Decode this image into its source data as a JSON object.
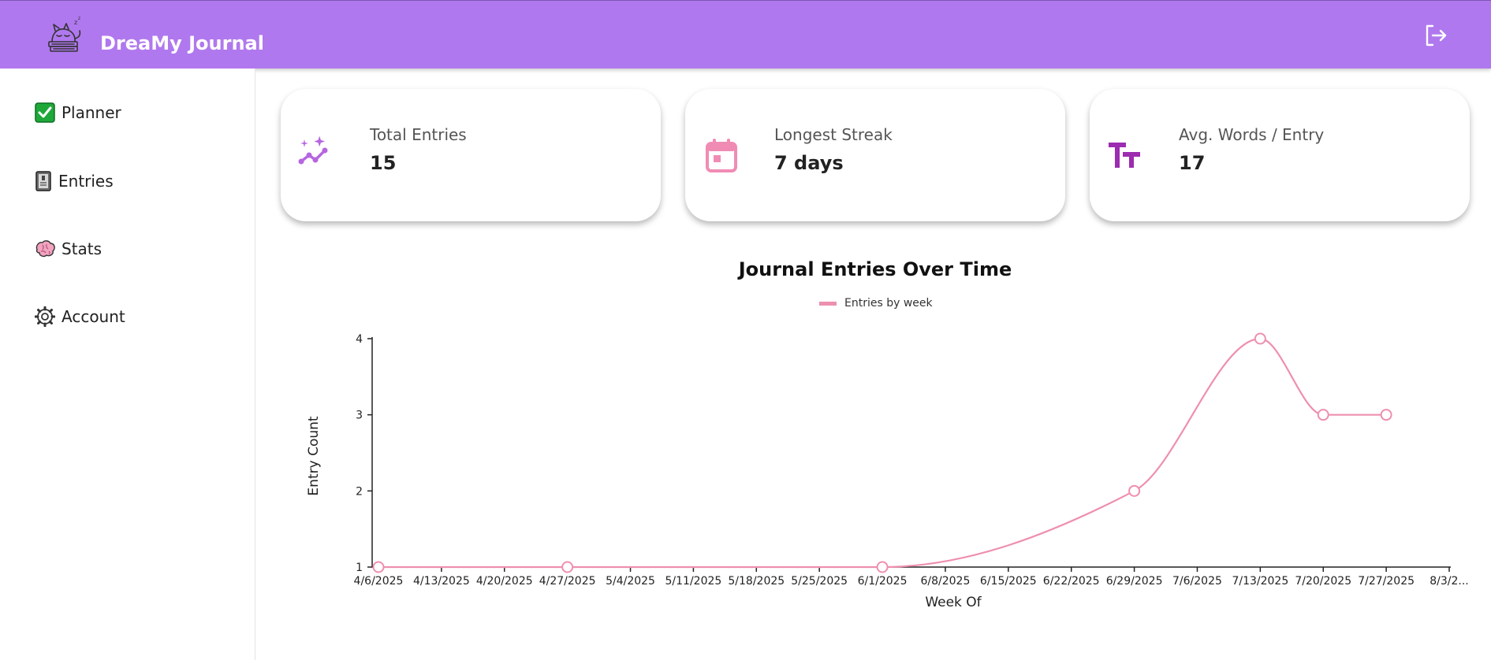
{
  "app": {
    "title": "DreaMy Journal",
    "logo_icon": "sleeping-cat-on-books-icon",
    "logout_icon": "logout-icon"
  },
  "sidebar": {
    "items": [
      {
        "label": "Planner",
        "icon": "checkmark-box-icon"
      },
      {
        "label": "Entries",
        "icon": "notebook-icon"
      },
      {
        "label": "Stats",
        "icon": "brain-icon"
      },
      {
        "label": "Account",
        "icon": "gear-icon"
      }
    ]
  },
  "stats": {
    "cards": [
      {
        "label": "Total Entries",
        "value": "15",
        "icon": "trend-sparkle-icon",
        "icon_color": "#b566e0"
      },
      {
        "label": "Longest Streak",
        "value": "7 days",
        "icon": "calendar-icon",
        "icon_color": "#f08cb4"
      },
      {
        "label": "Avg. Words / Entry",
        "value": "17",
        "icon": "text-size-icon",
        "icon_color": "#9c2cb0"
      }
    ]
  },
  "colors": {
    "header": "#b078ee",
    "line": "#ee8fb0"
  },
  "chart_data": {
    "type": "line",
    "title": "Journal Entries Over Time",
    "xlabel": "Week Of",
    "ylabel": "Entry Count",
    "legend": "top-center",
    "series": [
      {
        "name": "Entries by week",
        "points": [
          {
            "x": "2025-04-06",
            "y": 1
          },
          {
            "x": "2025-04-27",
            "y": 1
          },
          {
            "x": "2025-06-01",
            "y": 1
          },
          {
            "x": "2025-06-29",
            "y": 2
          },
          {
            "x": "2025-07-13",
            "y": 4
          },
          {
            "x": "2025-07-20",
            "y": 3
          },
          {
            "x": "2025-07-27",
            "y": 3
          }
        ]
      }
    ],
    "x_ticks": [
      "4/6/2025",
      "4/13/2025",
      "4/20/2025",
      "4/27/2025",
      "5/4/2025",
      "5/11/2025",
      "5/18/2025",
      "5/25/2025",
      "6/1/2025",
      "6/8/2025",
      "6/15/2025",
      "6/22/2025",
      "6/29/2025",
      "7/6/2025",
      "7/13/2025",
      "7/20/2025",
      "7/27/2025",
      "8/3/2..."
    ],
    "x_range": [
      "2025-04-06",
      "2025-08-03"
    ],
    "y_ticks": [
      1,
      2,
      3,
      4
    ],
    "ylim": [
      1,
      4
    ],
    "grid": false
  }
}
